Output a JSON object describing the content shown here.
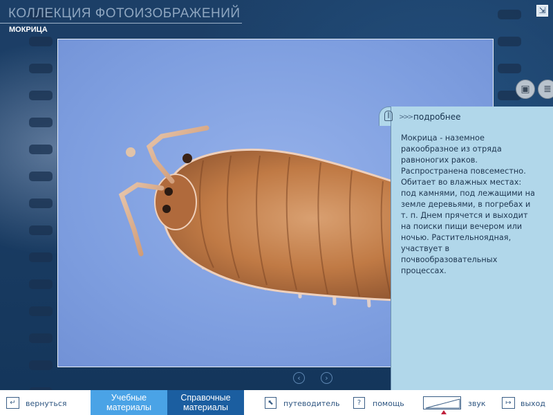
{
  "header": {
    "title": "КОЛЛЕКЦИЯ ФОТОИЗОБРАЖЕНИЙ",
    "subtitle": "МОКРИЦА",
    "corner_icon": "collapse-arrow-icon"
  },
  "viewer": {
    "image_subject": "woodlouse",
    "prev_icon": "chevron-left-icon",
    "next_icon": "chevron-right-icon",
    "tool_icons": [
      "briefcase-icon",
      "document-icon"
    ]
  },
  "info": {
    "heading": "подробнее",
    "lines": [
      "Мокрица - наземное",
      "ракообразное из отряда",
      "равноногих раков.",
      "Распространена повсеместно.",
      "Обитает во влажных местах:",
      "под камнями, под лежащими на",
      "земле деревьями, в погребах и",
      "т. п. Днем прячется и выходит",
      "на поиски пищи вечером или",
      "ночью. Растительноядная,",
      "участвует в",
      "почвообразовательных",
      "процессах."
    ]
  },
  "bottom_bar": {
    "back_label": "вернуться",
    "tab_study_line1": "Учебные",
    "tab_study_line2": "материалы",
    "tab_ref_line1": "Справочные",
    "tab_ref_line2": "материалы",
    "guide_label": "путеводитель",
    "help_label": "помощь",
    "help_icon_text": "?",
    "sound_label": "звук",
    "exit_label": "выход"
  },
  "colors": {
    "background": "#1a3c63",
    "panel": "#b1d7ea",
    "tab_active": "#4aa3e6",
    "tab_inactive": "#1b5ea0",
    "volume_marker": "#c0203a"
  }
}
